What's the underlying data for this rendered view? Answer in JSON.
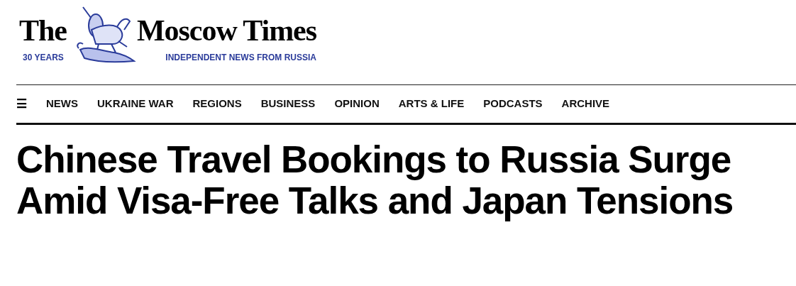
{
  "logo": {
    "word_left": "The",
    "word_right": "Moscow Times",
    "anniversary": "30 YEARS",
    "tagline": "INDEPENDENT NEWS FROM RUSSIA"
  },
  "nav": {
    "menu_glyph": "☰",
    "items": [
      {
        "label": "NEWS"
      },
      {
        "label": "UKRAINE WAR"
      },
      {
        "label": "REGIONS"
      },
      {
        "label": "BUSINESS"
      },
      {
        "label": "OPINION"
      },
      {
        "label": "ARTS & LIFE"
      },
      {
        "label": "PODCASTS"
      },
      {
        "label": "ARCHIVE"
      }
    ]
  },
  "article": {
    "headline": "Chinese Travel Bookings to Russia Surge Amid Visa-Free Talks and Japan Tensions"
  }
}
